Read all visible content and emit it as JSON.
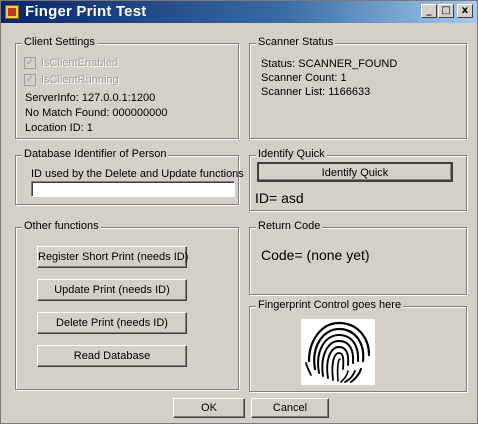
{
  "window": {
    "title": "Finger Print Test",
    "controls": {
      "minimize": "_",
      "maximize": "□",
      "close": "x"
    }
  },
  "client_settings": {
    "legend": "Client Settings",
    "is_client_enabled": {
      "label": "IsClientEnabled",
      "checked": true
    },
    "is_client_running": {
      "label": "IsClientRunning",
      "checked": true
    },
    "server_info": "ServerInfo:   127.0.0.1:1200",
    "no_match_found": "No Match Found:   000000000",
    "location_id": "Location ID:   1"
  },
  "scanner_status": {
    "legend": "Scanner Status",
    "status": "Status:   SCANNER_FOUND",
    "count": "Scanner Count:    1",
    "list": "Scanner List:    1166633"
  },
  "database_identifier": {
    "legend": "Database Identifier of Person",
    "label": "ID used by the Delete and Update functions",
    "value": ""
  },
  "identify_quick": {
    "legend": "Identify Quick",
    "button": "Identify Quick",
    "result": "ID= asd"
  },
  "other_functions": {
    "legend": "Other functions",
    "register": "Register Short Print (needs ID)",
    "update": "Update Print (needs ID)",
    "delete": "Delete Print (needs ID)",
    "read": "Read Database"
  },
  "return_code": {
    "legend": "Return Code",
    "text": "Code= (none yet)"
  },
  "fingerprint": {
    "legend": "Fingerprint Control goes here",
    "icon": "fingerprint-image"
  },
  "footer": {
    "ok": "OK",
    "cancel": "Cancel"
  }
}
